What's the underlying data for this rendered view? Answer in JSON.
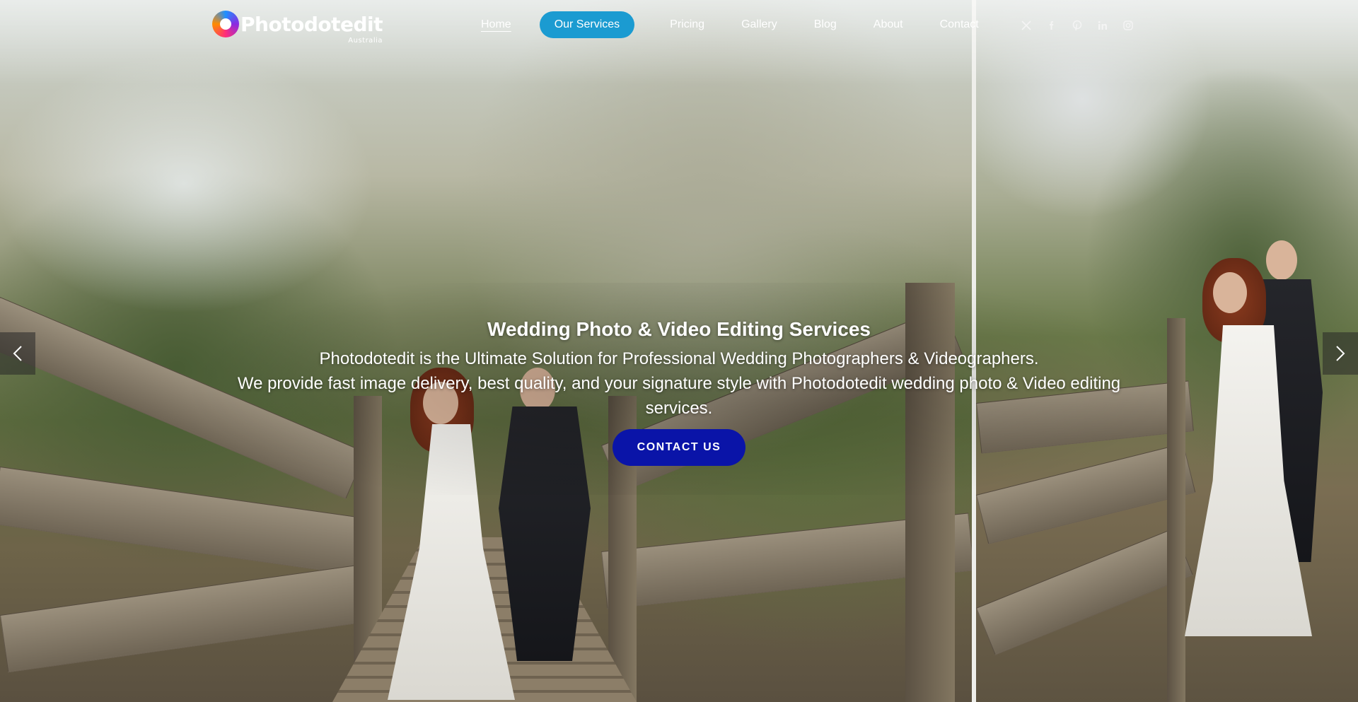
{
  "brand": {
    "name": "Photodotedit",
    "sub": "Australia"
  },
  "nav": {
    "items": [
      {
        "label": "Home",
        "state": "active"
      },
      {
        "label": "Our Services",
        "state": "highlight"
      },
      {
        "label": "Pricing",
        "state": ""
      },
      {
        "label": "Gallery",
        "state": ""
      },
      {
        "label": "Blog",
        "state": ""
      },
      {
        "label": "About",
        "state": ""
      },
      {
        "label": "Contact",
        "state": ""
      }
    ]
  },
  "socials": [
    "x-icon",
    "facebook-icon",
    "pinterest-icon",
    "linkedin-icon",
    "instagram-icon"
  ],
  "hero": {
    "title": "Wedding Photo & Video Editing Services",
    "line1": "Photodotedit is the Ultimate Solution for Professional Wedding Photographers & Videographers.",
    "line2": "We provide fast image delivery, best quality, and your signature style with Photodotedit wedding photo & Video editing services.",
    "cta": "CONTACT US"
  },
  "colors": {
    "highlight": "#1b9bd1",
    "cta": "#0a14a8"
  }
}
